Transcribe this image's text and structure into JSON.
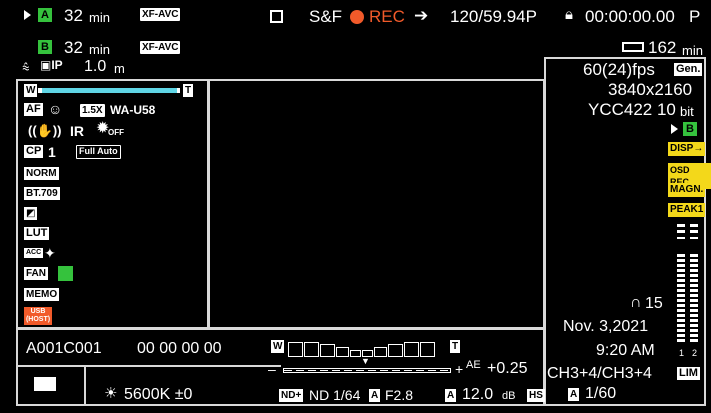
{
  "top": {
    "slot_a_label": "A",
    "slot_a_time": "32",
    "slot_a_unit": "min",
    "slot_a_format": "XF-AVC",
    "slot_b_label": "B",
    "slot_b_time": "32",
    "slot_b_unit": "min",
    "slot_b_format": "XF-AVC",
    "network_distance": "1.0",
    "network_unit": "m",
    "sf_label": "S&F",
    "rec_label": "REC",
    "frame_rate": "120/59.94P",
    "timecode": "00:00:00.00",
    "timecode_suffix": "P",
    "battery_time": "162",
    "battery_unit": "min"
  },
  "left_panel": {
    "zoom_w": "W",
    "zoom_t": "T",
    "af_label": "AF",
    "converter": "1.5X",
    "lens": "WA-U58",
    "ir_label": "IR",
    "off_label": "OFF",
    "cp_label": "CP",
    "cp_value": "1",
    "full_auto": "Full Auto",
    "norm_label": "NORM",
    "bt709_label": "BT.709",
    "lut_label": "LUT",
    "acc_label": "ACC",
    "fan_label": "FAN",
    "memo_label": "MEMO",
    "usb_label": "USB (HOST)"
  },
  "right_panel": {
    "fps": "60(24)fps",
    "gen_label": "Gen.",
    "resolution": "3840x2160",
    "color": "YCC422 10",
    "bit_label": "bit",
    "slot_b": "B",
    "disp": "DISP→",
    "osd_rec": "OSD REC",
    "magn": "MAGN.",
    "peak": "PEAK1",
    "headphone_level": "15",
    "date": "Nov. 3,2021",
    "time": "9:20 AM",
    "ch_label_1": "1",
    "ch_label_2": "2",
    "audio_channels": "CH3+4/CH3+4",
    "lim_label": "LIM"
  },
  "bottom": {
    "clip_name": "A001C001",
    "clip_tc": "00 00 00 00",
    "ae_plus": "+",
    "ae_label": "AE",
    "ae_value": "+0.25",
    "ae_minus": "–",
    "wb_value": "5600K ±0",
    "nd_plus": "ND+",
    "nd_value": "ND 1/64",
    "aperture_label": "A",
    "aperture": "F2.8",
    "gain_label": "A",
    "gain": "12.0",
    "gain_unit": "dB",
    "hs_label": "HS",
    "shutter_label": "A",
    "shutter": "1/60",
    "meter_w": "W",
    "meter_t": "T"
  }
}
